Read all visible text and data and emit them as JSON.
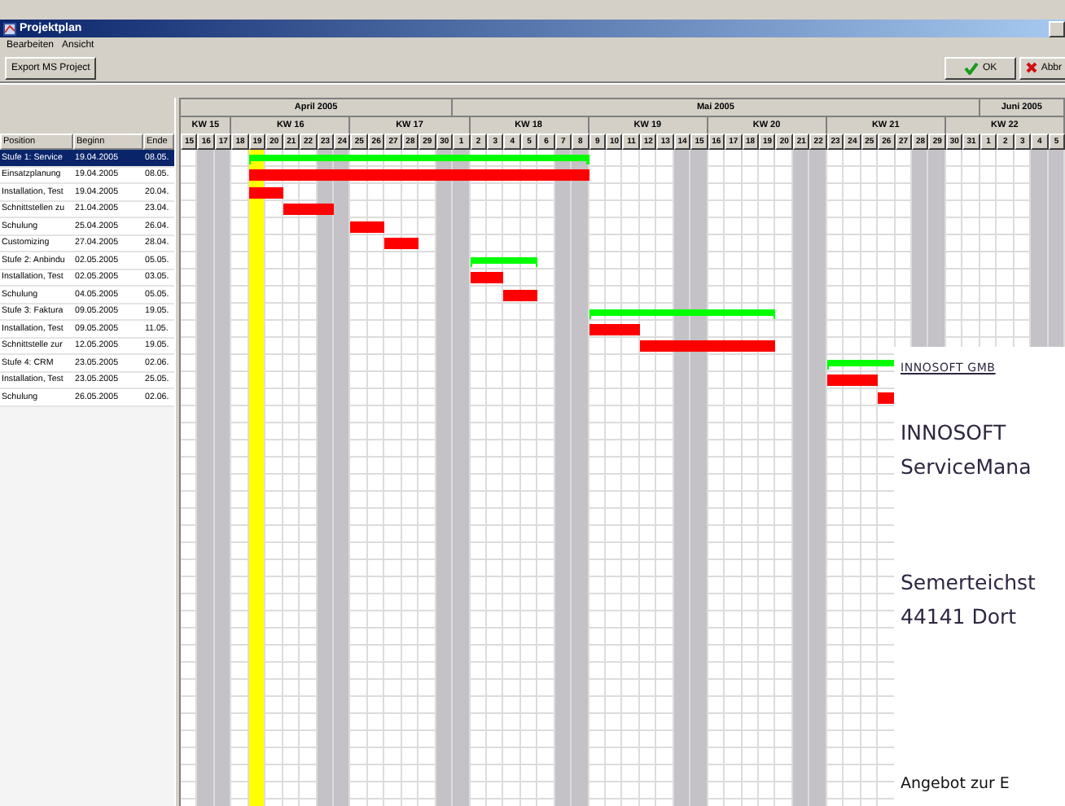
{
  "window": {
    "title": "Projektplan"
  },
  "menu": [
    "Bearbeiten",
    "Ansicht"
  ],
  "toolbar": {
    "export": "Export MS Project",
    "ok": "OK",
    "cancel": "Abbr"
  },
  "table": {
    "columns": [
      "Position",
      "Beginn",
      "Ende"
    ],
    "rows": [
      {
        "position": "Stufe 1: Service",
        "beginn": "19.04.2005",
        "ende": "08.05.",
        "kind": "summary",
        "selected": true
      },
      {
        "position": "Einsatzplanung",
        "beginn": "19.04.2005",
        "ende": "08.05.",
        "kind": "task",
        "selected": false
      },
      {
        "position": "Installation, Test",
        "beginn": "19.04.2005",
        "ende": "20.04.",
        "kind": "task",
        "selected": false
      },
      {
        "position": "Schnittstellen zu",
        "beginn": "21.04.2005",
        "ende": "23.04.",
        "kind": "task",
        "selected": false
      },
      {
        "position": "Schulung",
        "beginn": "25.04.2005",
        "ende": "26.04.",
        "kind": "task",
        "selected": false
      },
      {
        "position": "Customizing",
        "beginn": "27.04.2005",
        "ende": "28.04.",
        "kind": "task",
        "selected": false
      },
      {
        "position": "Stufe 2: Anbindu",
        "beginn": "02.05.2005",
        "ende": "05.05.",
        "kind": "summary",
        "selected": false
      },
      {
        "position": "Installation, Test",
        "beginn": "02.05.2005",
        "ende": "03.05.",
        "kind": "task",
        "selected": false
      },
      {
        "position": "Schulung",
        "beginn": "04.05.2005",
        "ende": "05.05.",
        "kind": "task",
        "selected": false
      },
      {
        "position": "Stufe 3: Faktura",
        "beginn": "09.05.2005",
        "ende": "19.05.",
        "kind": "summary",
        "selected": false
      },
      {
        "position": "Installation, Test",
        "beginn": "09.05.2005",
        "ende": "11.05.",
        "kind": "task",
        "selected": false
      },
      {
        "position": "Schnittstelle zur",
        "beginn": "12.05.2005",
        "ende": "19.05.",
        "kind": "task",
        "selected": false
      },
      {
        "position": "Stufe 4: CRM",
        "beginn": "23.05.2005",
        "ende": "02.06.",
        "kind": "summary",
        "selected": false
      },
      {
        "position": "Installation, Test",
        "beginn": "23.05.2005",
        "ende": "25.05.",
        "kind": "task",
        "selected": false
      },
      {
        "position": "Schulung",
        "beginn": "26.05.2005",
        "ende": "02.06.",
        "kind": "task",
        "selected": false
      }
    ]
  },
  "timeline": {
    "months": [
      "April 2005",
      "Mai 2005",
      "Juni 2005"
    ],
    "weeks": [
      "KW 15",
      "KW 16",
      "KW 17",
      "KW 18",
      "KW 19",
      "KW 20",
      "KW 21",
      "KW 22"
    ],
    "days": [
      {
        "label": "15",
        "weekend": false,
        "today": false
      },
      {
        "label": "16",
        "weekend": true,
        "today": false
      },
      {
        "label": "17",
        "weekend": true,
        "today": false
      },
      {
        "label": "18",
        "weekend": false,
        "today": false
      },
      {
        "label": "19",
        "weekend": false,
        "today": true
      },
      {
        "label": "20",
        "weekend": false,
        "today": false
      },
      {
        "label": "21",
        "weekend": false,
        "today": false
      },
      {
        "label": "22",
        "weekend": false,
        "today": false
      },
      {
        "label": "23",
        "weekend": true,
        "today": false
      },
      {
        "label": "24",
        "weekend": true,
        "today": false
      },
      {
        "label": "25",
        "weekend": false,
        "today": false
      },
      {
        "label": "26",
        "weekend": false,
        "today": false
      },
      {
        "label": "27",
        "weekend": false,
        "today": false
      },
      {
        "label": "28",
        "weekend": false,
        "today": false
      },
      {
        "label": "29",
        "weekend": false,
        "today": false
      },
      {
        "label": "30",
        "weekend": true,
        "today": false
      },
      {
        "label": "1",
        "weekend": true,
        "today": false
      },
      {
        "label": "2",
        "weekend": false,
        "today": false
      },
      {
        "label": "3",
        "weekend": false,
        "today": false
      },
      {
        "label": "4",
        "weekend": false,
        "today": false
      },
      {
        "label": "5",
        "weekend": false,
        "today": false
      },
      {
        "label": "6",
        "weekend": false,
        "today": false
      },
      {
        "label": "7",
        "weekend": true,
        "today": false
      },
      {
        "label": "8",
        "weekend": true,
        "today": false
      },
      {
        "label": "9",
        "weekend": false,
        "today": false
      },
      {
        "label": "10",
        "weekend": false,
        "today": false
      },
      {
        "label": "11",
        "weekend": false,
        "today": false
      },
      {
        "label": "12",
        "weekend": false,
        "today": false
      },
      {
        "label": "13",
        "weekend": false,
        "today": false
      },
      {
        "label": "14",
        "weekend": true,
        "today": false
      },
      {
        "label": "15",
        "weekend": true,
        "today": false
      },
      {
        "label": "16",
        "weekend": false,
        "today": false
      },
      {
        "label": "17",
        "weekend": false,
        "today": false
      },
      {
        "label": "18",
        "weekend": false,
        "today": false
      },
      {
        "label": "19",
        "weekend": false,
        "today": false
      },
      {
        "label": "20",
        "weekend": false,
        "today": false
      },
      {
        "label": "21",
        "weekend": true,
        "today": false
      },
      {
        "label": "22",
        "weekend": true,
        "today": false
      },
      {
        "label": "23",
        "weekend": false,
        "today": false
      },
      {
        "label": "24",
        "weekend": false,
        "today": false
      },
      {
        "label": "25",
        "weekend": false,
        "today": false
      },
      {
        "label": "26",
        "weekend": false,
        "today": false
      },
      {
        "label": "27",
        "weekend": false,
        "today": false
      },
      {
        "label": "28",
        "weekend": true,
        "today": false
      },
      {
        "label": "29",
        "weekend": true,
        "today": false
      },
      {
        "label": "30",
        "weekend": false,
        "today": false
      },
      {
        "label": "31",
        "weekend": false,
        "today": false
      },
      {
        "label": "1",
        "weekend": false,
        "today": false
      },
      {
        "label": "2",
        "weekend": false,
        "today": false
      },
      {
        "label": "3",
        "weekend": false,
        "today": false
      },
      {
        "label": "4",
        "weekend": true,
        "today": false
      },
      {
        "label": "5",
        "weekend": true,
        "today": false
      }
    ]
  },
  "document": {
    "header": "INNOSOFT GMB",
    "company": "INNOSOFT",
    "product": "ServiceMana",
    "street": "Semerteichst",
    "city": "44141 Dort",
    "subject": "Angebot zur E"
  }
}
